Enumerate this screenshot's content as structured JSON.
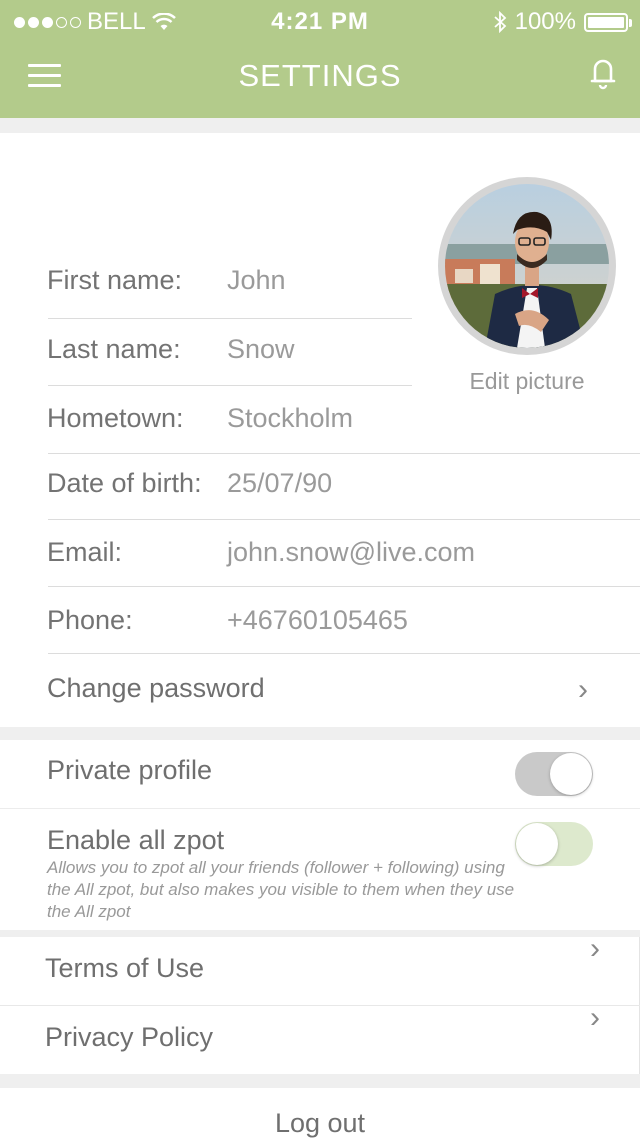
{
  "status_bar": {
    "carrier": "BELL",
    "time": "4:21 PM",
    "battery": "100%",
    "signal_dots": 5,
    "signal_filled": 3
  },
  "header": {
    "title": "SETTINGS",
    "menu_icon": "hamburger-menu-icon",
    "notification_icon": "bell-icon"
  },
  "profile": {
    "fields": [
      {
        "label": "First name:",
        "value": "John"
      },
      {
        "label": "Last name:",
        "value": "Snow"
      },
      {
        "label": "Hometown:",
        "value": "Stockholm"
      },
      {
        "label": "Date of birth:",
        "value": "25/07/90"
      },
      {
        "label": "Email:",
        "value": "john.snow@live.com"
      },
      {
        "label": "Phone:",
        "value": "+46760105465"
      }
    ],
    "edit_picture": "Edit picture",
    "change_password": "Change password"
  },
  "privacy": {
    "private_profile": {
      "label": "Private profile",
      "enabled": false
    },
    "enable_all_zpot": {
      "label": "Enable all zpot",
      "description": "Allows you to zpot all your friends (follower + following) using the All zpot, but also makes you visible to them when they use the All zpot",
      "enabled": false
    }
  },
  "legal": {
    "terms": "Terms of Use",
    "privacy_policy": "Privacy Policy"
  },
  "logout": "Log out",
  "colors": {
    "header_green": "#b3cb8b",
    "toggle_gray": "#c9c9c9",
    "toggle_green": "#dde9cd",
    "background": "#efefef"
  }
}
